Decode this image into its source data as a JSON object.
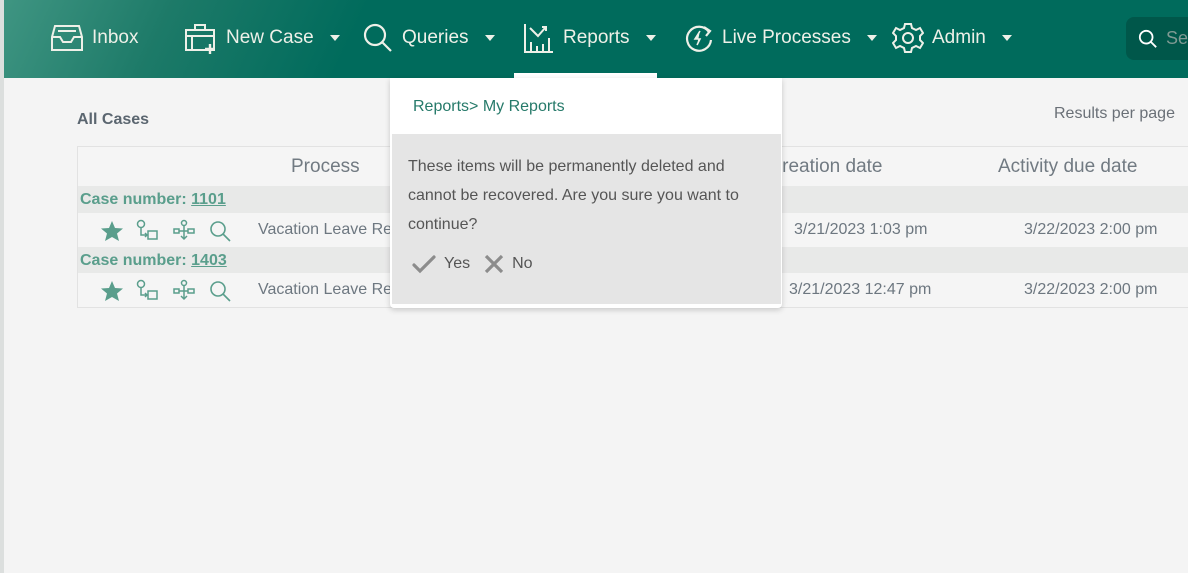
{
  "nav": {
    "items": [
      {
        "label": "Inbox",
        "icon": "inbox-icon",
        "has_dropdown": false
      },
      {
        "label": "New Case",
        "icon": "new-case-icon",
        "has_dropdown": true
      },
      {
        "label": "Queries",
        "icon": "search-icon",
        "has_dropdown": true
      },
      {
        "label": "Reports",
        "icon": "reports-chart-icon",
        "has_dropdown": true,
        "active": true
      },
      {
        "label": "Live Processes",
        "icon": "live-process-icon",
        "has_dropdown": true
      },
      {
        "label": "Admin",
        "icon": "gear-icon",
        "has_dropdown": true
      }
    ],
    "search_placeholder": "Search"
  },
  "main": {
    "title": "All Cases",
    "results_per_page_label": "Results per page",
    "columns": [
      "Process",
      "Case creation date",
      "Activity due date"
    ],
    "groups": [
      {
        "label": "Case number: ",
        "case_number": "1101",
        "row": {
          "process": "Vacation Leave Request",
          "creation_date": "3/21/2023 1:03 pm",
          "due_date": "3/22/2023 2:00 pm"
        }
      },
      {
        "label": "Case number: ",
        "case_number": "1403",
        "row": {
          "process": "Vacation Leave Request",
          "creation_date": "3/21/2023 12:47 pm",
          "due_date": "3/22/2023 2:00 pm"
        }
      }
    ]
  },
  "dropdown": {
    "breadcrumb": "Reports> My Reports",
    "confirm_message": "These items will be permanently deleted and cannot be recovered. Are you sure you want to continue?",
    "yes_label": "Yes",
    "no_label": "No"
  },
  "colors": {
    "nav_bg": "#006b5c",
    "accent": "#5a9e8c",
    "link": "#267a6a"
  }
}
